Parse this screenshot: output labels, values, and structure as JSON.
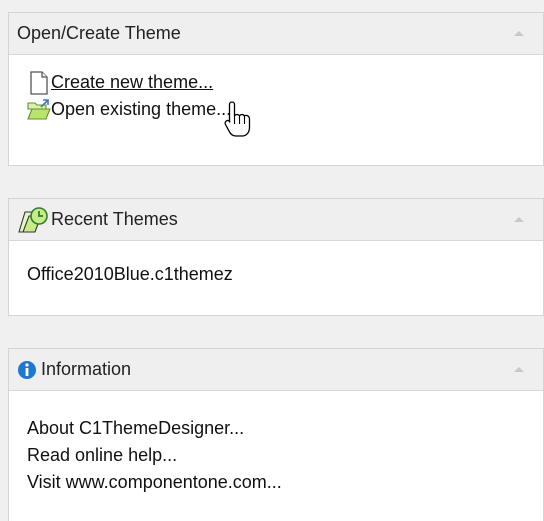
{
  "open_create": {
    "title": "Open/Create Theme",
    "items": [
      {
        "label": "Create new theme...",
        "icon": "new-document-icon"
      },
      {
        "label": "Open existing theme...",
        "icon": "open-folder-icon"
      }
    ]
  },
  "recent": {
    "title": "Recent Themes",
    "icon": "recent-themes-clock-icon",
    "items": [
      {
        "label": "Office2010Blue.c1themez"
      }
    ]
  },
  "information": {
    "title": "Information",
    "icon": "info-icon",
    "items": [
      {
        "label": "About C1ThemeDesigner..."
      },
      {
        "label": "Read online help..."
      },
      {
        "label": "Visit www.componentone.com..."
      }
    ]
  },
  "colors": {
    "background": "#f0f0f0",
    "header_bg": "#efefef",
    "panel_bg": "#ffffff",
    "border": "#d4d4d4",
    "info_blue": "#1e78d2",
    "folder_green": "#b7e46a"
  }
}
